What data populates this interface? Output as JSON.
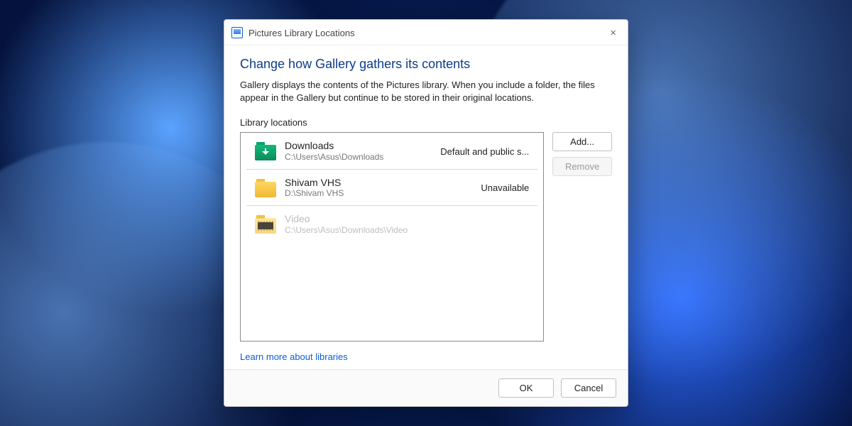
{
  "titlebar": {
    "title": "Pictures Library Locations",
    "close_label": "×"
  },
  "heading": "Change how Gallery gathers its contents",
  "description": "Gallery displays the contents of the Pictures library. When you include a folder, the files appear in the Gallery but continue to be stored in their original locations.",
  "section_label": "Library locations",
  "buttons": {
    "add": "Add...",
    "remove": "Remove",
    "ok": "OK",
    "cancel": "Cancel"
  },
  "learn_more": "Learn more about libraries",
  "locations": [
    {
      "name": "Downloads",
      "path": "C:\\Users\\Asus\\Downloads",
      "status": "Default and public s...",
      "icon": "download-folder",
      "selected": true,
      "ghost": false
    },
    {
      "name": "Shivam VHS",
      "path": "D:\\Shivam VHS",
      "status": "Unavailable",
      "icon": "folder",
      "selected": true,
      "ghost": false
    },
    {
      "name": "Video",
      "path": "C:\\Users\\Asus\\Downloads\\Video",
      "status": "",
      "icon": "video-folder",
      "selected": false,
      "ghost": true
    }
  ]
}
